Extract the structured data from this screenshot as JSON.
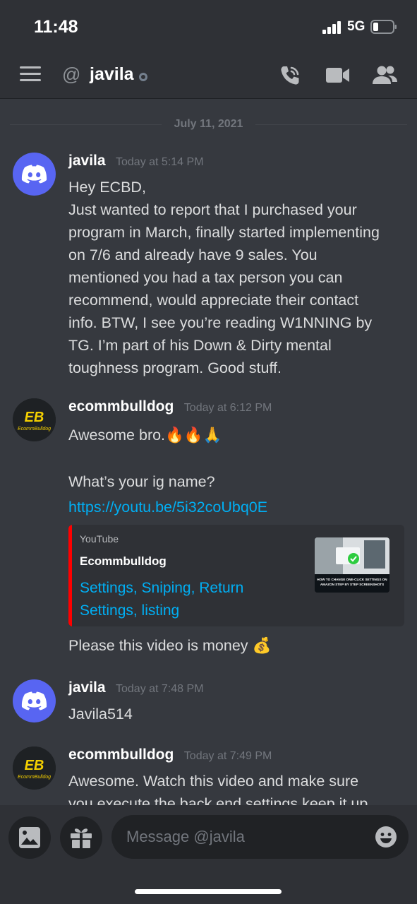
{
  "status_bar": {
    "time": "11:48",
    "network": "5G"
  },
  "header": {
    "channel_name": "javila"
  },
  "date_divider": "July 11, 2021",
  "messages": [
    {
      "author": "javila",
      "timestamp": "Today at 5:14 PM",
      "lines": [
        "Hey ECBD,",
        "Just wanted to report that I purchased your",
        "program in March, finally started implementing",
        "on 7/6 and already have 9 sales. You",
        "mentioned you had a tax person you can",
        "recommend, would appreciate their contact",
        "info. BTW, I see you’re reading W1NNING by",
        "TG. I’m part of his Down & Dirty mental",
        "toughness program. Good stuff."
      ]
    },
    {
      "author": "ecommbulldog",
      "timestamp": "Today at 6:12 PM",
      "line1": "Awesome bro.🔥🔥🙏",
      "line2": "What’s your ig name?",
      "link": "https://youtu.be/5i32coUbq0E",
      "embed": {
        "provider": "YouTube",
        "author": "Ecommbulldog",
        "title_line1": "Settings, Sniping, Return",
        "title_line2": "Settings, listing",
        "thumb_text_1": "HOW TO CHANGE ONE-CLICK SETTINGS ON",
        "thumb_text_2": "AMAZON STEP BY STEP SCREENSHOTS"
      },
      "after": "Please this video is money 💰"
    },
    {
      "author": "javila",
      "timestamp": "Today at 7:48 PM",
      "text": "Javila514"
    },
    {
      "author": "ecommbulldog",
      "timestamp": "Today at 7:49 PM",
      "line1": "Awesome. Watch this video and make sure",
      "line2": "you execute the back end settings keep it up"
    }
  ],
  "avatar_logo": {
    "initials": "EB",
    "caption": "EcommBulldog"
  },
  "composer": {
    "placeholder": "Message @javila"
  },
  "colors": {
    "background": "#36393f",
    "header": "#2f3136",
    "blurple": "#5865f2",
    "link": "#00aff4",
    "youtube_red": "#ff0000"
  },
  "icons": [
    "menu-icon",
    "phone-call-icon",
    "video-camera-icon",
    "members-icon",
    "image-icon",
    "gift-icon",
    "emoji-icon"
  ]
}
